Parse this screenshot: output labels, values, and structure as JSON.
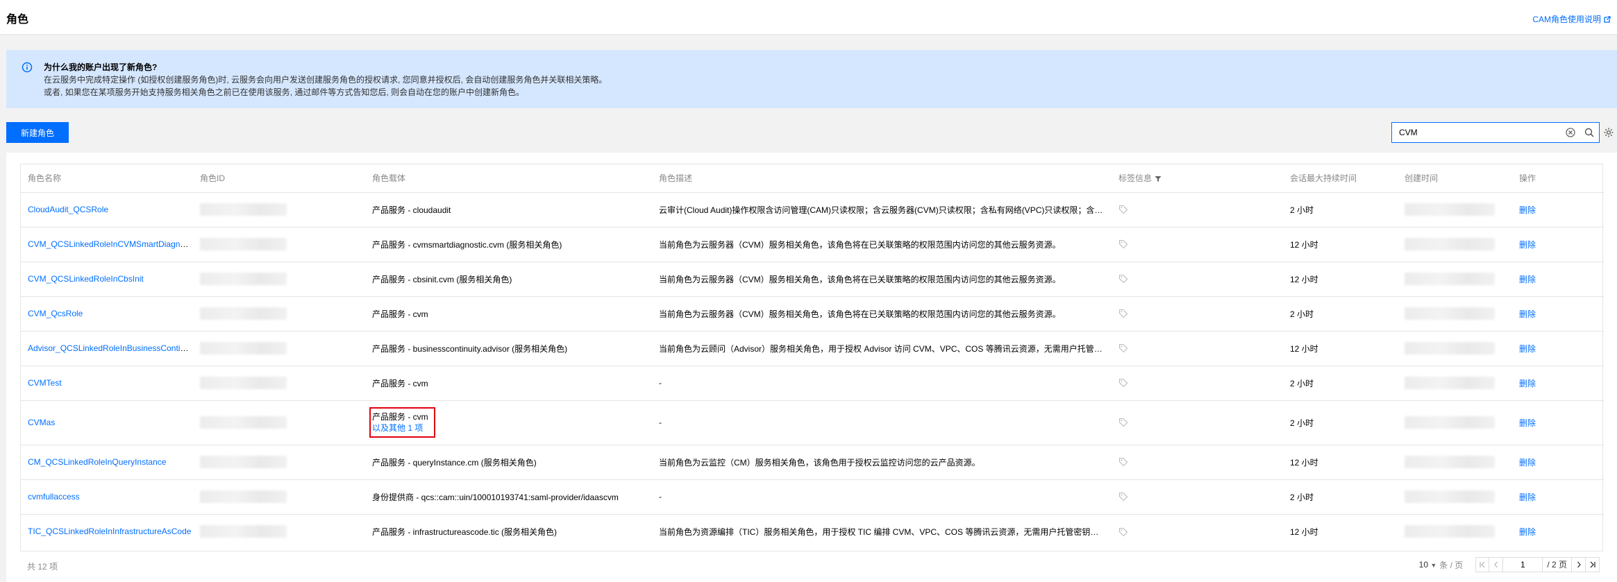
{
  "header": {
    "title": "角色",
    "doc_link": "CAM角色使用说明"
  },
  "banner": {
    "title": "为什么我的账户出现了新角色?",
    "line1": "在云服务中完成特定操作 (如授权创建服务角色)时, 云服务会向用户发送创建服务角色的授权请求, 您同意并授权后, 会自动创建服务角色并关联相关策略。",
    "line2": "或者, 如果您在某项服务开始支持服务相关角色之前已在使用该服务, 通过邮件等方式告知您后, 则会自动在您的账户中创建新角色。"
  },
  "toolbar": {
    "new_role_label": "新建角色",
    "search_value": "CVM"
  },
  "table": {
    "columns": [
      "角色名称",
      "角色ID",
      "角色载体",
      "角色描述",
      "标签信息",
      "会话最大持续时间",
      "创建时间",
      "操作"
    ],
    "delete_label": "删除",
    "rows": [
      {
        "name": "CloudAudit_QCSRole",
        "carrier": "产品服务 - cloudaudit",
        "carrier_more": "",
        "desc": "云审计(Cloud Audit)操作权限含访问管理(CAM)只读权限；含云服务器(CVM)只读权限；含私有网络(VPC)只读权限；含…",
        "duration": "2 小时"
      },
      {
        "name": "CVM_QCSLinkedRoleInCVMSmartDiagnostic",
        "carrier": "产品服务 - cvmsmartdiagnostic.cvm (服务相关角色)",
        "carrier_more": "",
        "desc": "当前角色为云服务器（CVM）服务相关角色，该角色将在已关联策略的权限范围内访问您的其他云服务资源。",
        "duration": "12 小时"
      },
      {
        "name": "CVM_QCSLinkedRoleInCbsInit",
        "carrier": "产品服务 - cbsinit.cvm (服务相关角色)",
        "carrier_more": "",
        "desc": "当前角色为云服务器（CVM）服务相关角色，该角色将在已关联策略的权限范围内访问您的其他云服务资源。",
        "duration": "12 小时"
      },
      {
        "name": "CVM_QcsRole",
        "carrier": "产品服务 - cvm",
        "carrier_more": "",
        "desc": "当前角色为云服务器（CVM）服务相关角色，该角色将在已关联策略的权限范围内访问您的其他云服务资源。",
        "duration": "2 小时"
      },
      {
        "name": "Advisor_QCSLinkedRoleInBusinessContinuity",
        "carrier": "产品服务 - businesscontinuity.advisor (服务相关角色)",
        "carrier_more": "",
        "desc": "当前角色为云顾问（Advisor）服务相关角色，用于授权 Advisor 访问 CVM、VPC、COS 等腾讯云资源，无需用户托管…",
        "duration": "12 小时"
      },
      {
        "name": "CVMTest",
        "carrier": "产品服务 - cvm",
        "carrier_more": "",
        "desc": "-",
        "duration": "2 小时"
      },
      {
        "name": "CVMas",
        "carrier": "产品服务 - cvm",
        "carrier_more_prefix": "以及",
        "carrier_more": "其他 1 项",
        "desc": "-",
        "duration": "2 小时"
      },
      {
        "name": "CM_QCSLinkedRoleInQueryInstance",
        "carrier": "产品服务 - queryInstance.cm (服务相关角色)",
        "carrier_more": "",
        "desc": "当前角色为云监控（CM）服务相关角色，该角色用于授权云监控访问您的云产品资源。",
        "duration": "12 小时"
      },
      {
        "name": "cvmfullaccess",
        "carrier": "身份提供商 - qcs::cam::uin/100010193741:saml-provider/idaascvm",
        "carrier_more": "",
        "desc": "-",
        "duration": "2 小时"
      },
      {
        "name": "TIC_QCSLinkedRoleInInfrastructureAsCode",
        "carrier": "产品服务 - infrastructureascode.tic (服务相关角色)",
        "carrier_more": "",
        "desc": "当前角色为资源编排（TIC）服务相关角色，用于授权 TIC 编排 CVM、VPC、COS 等腾讯云资源，无需用户托管密钥…",
        "duration": "12 小时"
      }
    ]
  },
  "footer": {
    "total": "共 12 项",
    "page_size": "10",
    "per_page": "条 / 页",
    "current_page": "1",
    "total_pages": "/ 2 页"
  },
  "colors": {
    "primary": "#006eff",
    "banner_bg": "#d5e7ff",
    "highlight_border": "#e1000e"
  }
}
